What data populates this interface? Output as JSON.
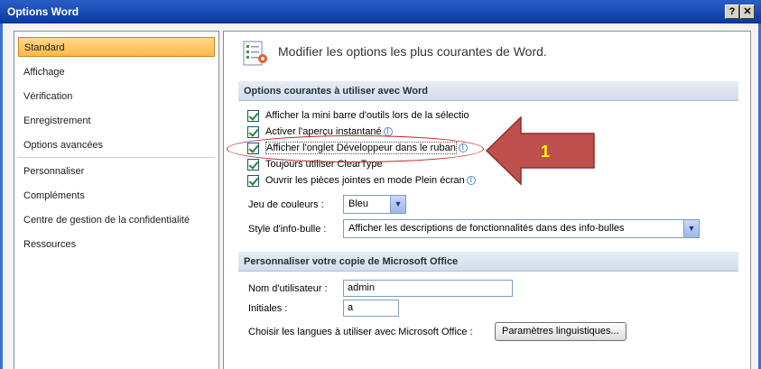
{
  "window": {
    "title": "Options Word",
    "help_glyph": "?",
    "close_glyph": "✕"
  },
  "sidebar": {
    "items": [
      {
        "label": "Standard"
      },
      {
        "label": "Affichage"
      },
      {
        "label": "Vérification"
      },
      {
        "label": "Enregistrement"
      },
      {
        "label": "Options avancées"
      },
      {
        "label": "Personnaliser"
      },
      {
        "label": "Compléments"
      },
      {
        "label": "Centre de gestion de la confidentialité"
      },
      {
        "label": "Ressources"
      }
    ],
    "selected": 0
  },
  "main": {
    "heading": "Modifier les options les plus courantes de Word.",
    "section1": {
      "title": "Options courantes à utiliser avec Word",
      "checkboxes": [
        {
          "label": "Afficher la mini barre d'outils lors de la sélectio",
          "checked": true
        },
        {
          "label": "Activer l'aperçu instantané",
          "checked": true
        },
        {
          "label": "Afficher l'onglet Développeur dans le ruban",
          "checked": true
        },
        {
          "label": "Toujours utiliser ClearType",
          "checked": true
        },
        {
          "label": "Ouvrir les pièces jointes en mode Plein écran",
          "checked": true
        }
      ],
      "color_scheme_label": "Jeu de couleurs :",
      "color_scheme_value": "Bleu",
      "tooltip_style_label": "Style d'info-bulle :",
      "tooltip_style_value": "Afficher les descriptions de fonctionnalités dans des info-bulles"
    },
    "section2": {
      "title": "Personnaliser votre copie de Microsoft Office",
      "username_label": "Nom d'utilisateur :",
      "username_value": "admin",
      "initials_label": "Initiales :",
      "initials_value": "a",
      "languages_label": "Choisir les langues à utiliser avec Microsoft Office :",
      "languages_button": "Paramètres linguistiques..."
    }
  },
  "annotation": {
    "number": "1",
    "arrow_color": "#c0504d",
    "number_color": "#ffff00"
  },
  "icons": {
    "info": "info-icon",
    "options": "options-icon"
  }
}
